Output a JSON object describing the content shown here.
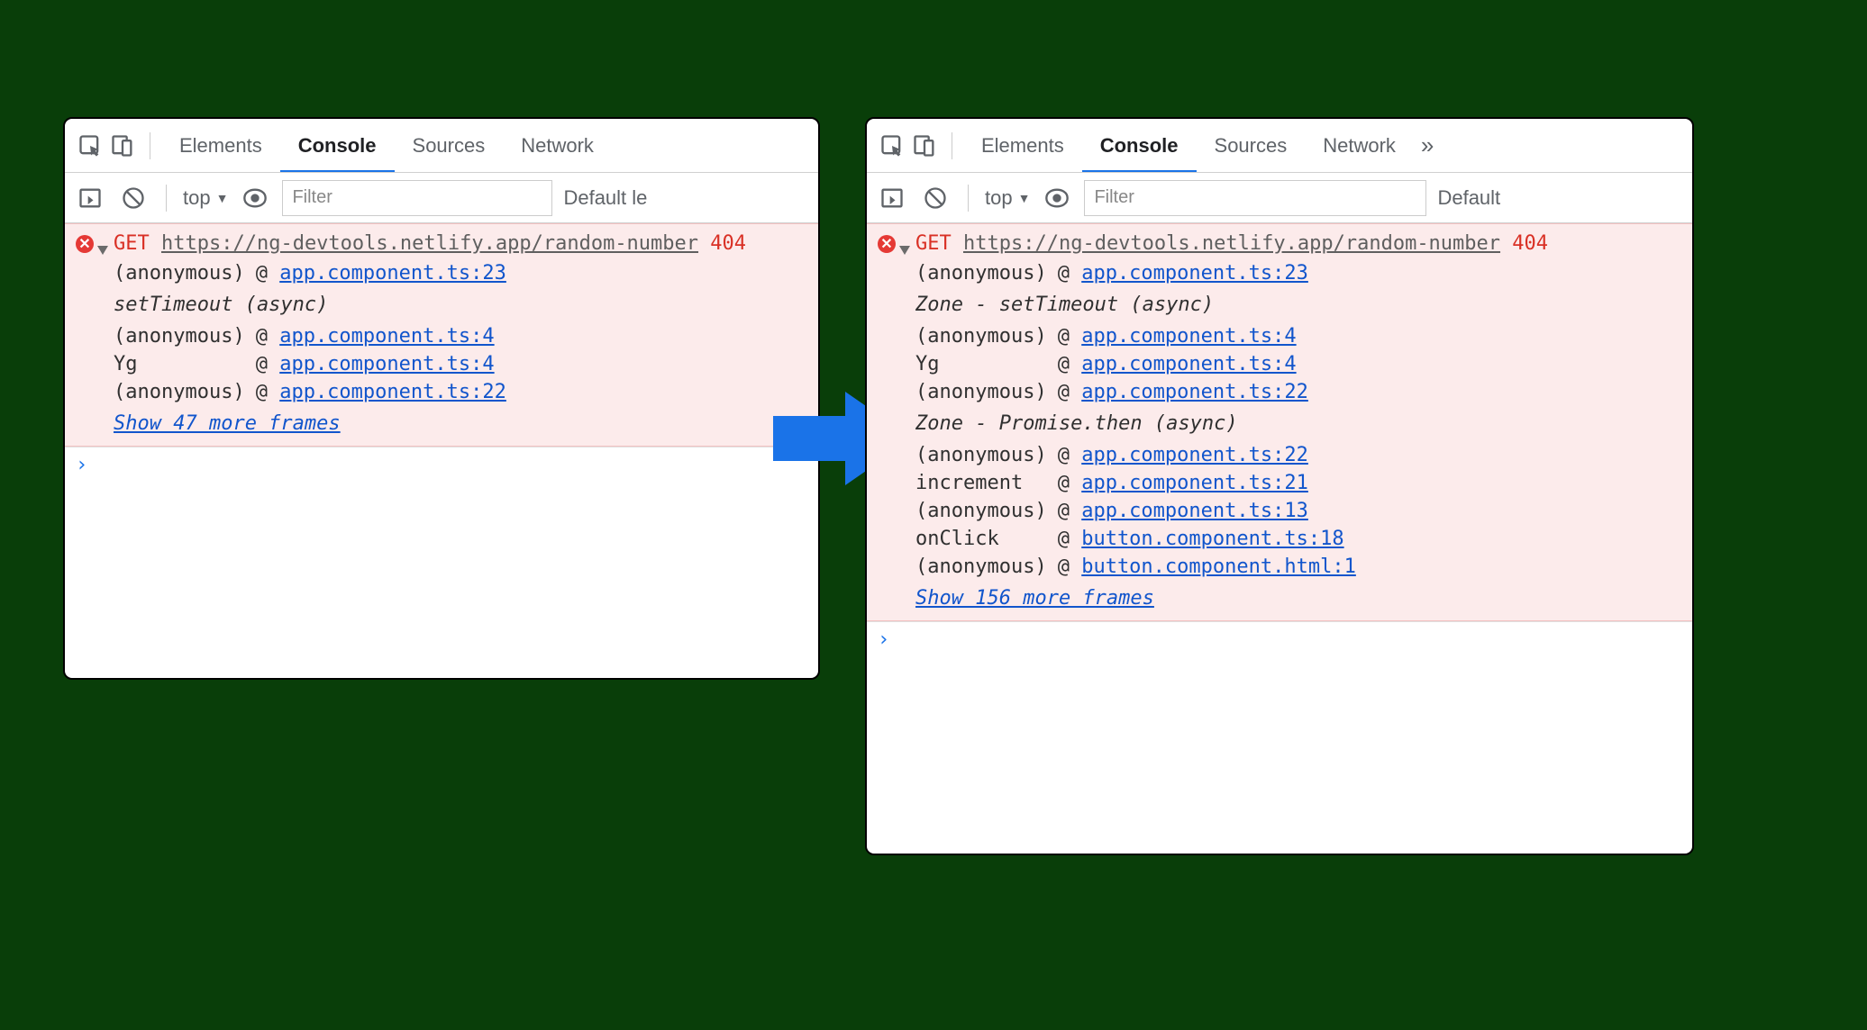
{
  "tabs": {
    "elements": "Elements",
    "console": "Console",
    "sources": "Sources",
    "network": "Network",
    "more": "»"
  },
  "toolbar": {
    "context": "top",
    "tri": "▼",
    "filter_placeholder": "Filter",
    "levels_left": "Default le",
    "levels_right": "Default"
  },
  "left": {
    "method": "GET",
    "url": "https://ng-devtools.netlify.app/random-number",
    "status": "404",
    "rows": [
      {
        "t": "frame",
        "fn": "(anonymous)",
        "loc": "app.component.ts:23"
      },
      {
        "t": "section",
        "label": "setTimeout (async)"
      },
      {
        "t": "frame",
        "fn": "(anonymous)",
        "loc": "app.component.ts:4"
      },
      {
        "t": "frame",
        "fn": "Yg",
        "loc": "app.component.ts:4"
      },
      {
        "t": "frame",
        "fn": "(anonymous)",
        "loc": "app.component.ts:22"
      }
    ],
    "more": "Show 47 more frames"
  },
  "right": {
    "method": "GET",
    "url": "https://ng-devtools.netlify.app/random-number",
    "status": "404",
    "rows": [
      {
        "t": "frame",
        "fn": "(anonymous)",
        "loc": "app.component.ts:23"
      },
      {
        "t": "section",
        "label": "Zone - setTimeout (async)"
      },
      {
        "t": "frame",
        "fn": "(anonymous)",
        "loc": "app.component.ts:4"
      },
      {
        "t": "frame",
        "fn": "Yg",
        "loc": "app.component.ts:4"
      },
      {
        "t": "frame",
        "fn": "(anonymous)",
        "loc": "app.component.ts:22"
      },
      {
        "t": "section",
        "label": "Zone - Promise.then (async)"
      },
      {
        "t": "frame",
        "fn": "(anonymous)",
        "loc": "app.component.ts:22"
      },
      {
        "t": "frame",
        "fn": "increment",
        "loc": "app.component.ts:21"
      },
      {
        "t": "frame",
        "fn": "(anonymous)",
        "loc": "app.component.ts:13"
      },
      {
        "t": "frame",
        "fn": "onClick",
        "loc": "button.component.ts:18"
      },
      {
        "t": "frame",
        "fn": "(anonymous)",
        "loc": "button.component.html:1"
      }
    ],
    "more": "Show 156 more frames"
  },
  "at": "@"
}
